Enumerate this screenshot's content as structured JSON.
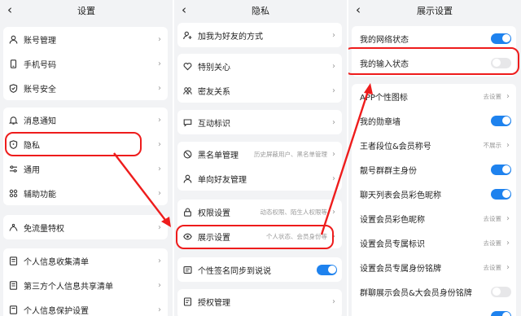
{
  "panel1": {
    "title": "设置",
    "items": [
      {
        "label": "账号管理",
        "icon": "person-icon"
      },
      {
        "label": "手机号码",
        "icon": "phone-icon"
      },
      {
        "label": "账号安全",
        "icon": "shield-check-icon"
      },
      {
        "label": "消息通知",
        "icon": "bell-icon"
      },
      {
        "label": "隐私",
        "icon": "shield-icon"
      },
      {
        "label": "通用",
        "icon": "sliders-icon"
      },
      {
        "label": "辅助功能",
        "icon": "grid-icon"
      },
      {
        "label": "免流量特权",
        "icon": "signal-icon"
      },
      {
        "label": "个人信息收集清单",
        "icon": "list-icon"
      },
      {
        "label": "第三方个人信息共享清单",
        "icon": "list-icon"
      },
      {
        "label": "个人信息保护设置",
        "icon": "doc-icon"
      }
    ]
  },
  "panel2": {
    "title": "隐私",
    "items": [
      {
        "label": "加我为好友的方式",
        "icon": "add-friend-icon"
      },
      {
        "label": "特别关心",
        "icon": "heart-icon"
      },
      {
        "label": "密友关系",
        "icon": "people-icon"
      },
      {
        "label": "互动标识",
        "icon": "chat-icon"
      },
      {
        "label": "黑名单管理",
        "icon": "block-icon",
        "hint": "历史屏蔽用户、黑名单管理"
      },
      {
        "label": "单向好友管理",
        "icon": "person-icon"
      },
      {
        "label": "权限设置",
        "icon": "lock-icon",
        "hint": "动态权限、陌生人权限等"
      },
      {
        "label": "展示设置",
        "icon": "eye-icon",
        "hint": "个人状态、会员身份等"
      },
      {
        "label": "个性签名同步到说说",
        "icon": "signature-icon",
        "toggle": true
      },
      {
        "label": "授权管理",
        "icon": "key-icon"
      }
    ]
  },
  "panel3": {
    "title": "展示设置",
    "items": [
      {
        "label": "我的网络状态",
        "toggle": true
      },
      {
        "label": "我的输入状态",
        "toggle": false
      },
      {
        "label": "APP个性图标",
        "hint": "去设置"
      },
      {
        "label": "我的勋章墙",
        "toggle": true
      },
      {
        "label": "王者段位&会员称号",
        "hint": "不展示"
      },
      {
        "label": "靓号群群主身份",
        "toggle": true
      },
      {
        "label": "聊天列表会员彩色昵称",
        "toggle": true
      },
      {
        "label": "设置会员彩色昵称",
        "hint": "去设置"
      },
      {
        "label": "设置会员专属标识",
        "hint": "去设置"
      },
      {
        "label": "设置会员专属身份铭牌",
        "hint": "去设置"
      },
      {
        "label": "群聊展示会员&大会员身份铭牌",
        "toggle": false
      }
    ]
  },
  "colors": {
    "accent": "#1e82ee",
    "annotation": "#ee1c1c",
    "background": "#f2f3f5"
  }
}
